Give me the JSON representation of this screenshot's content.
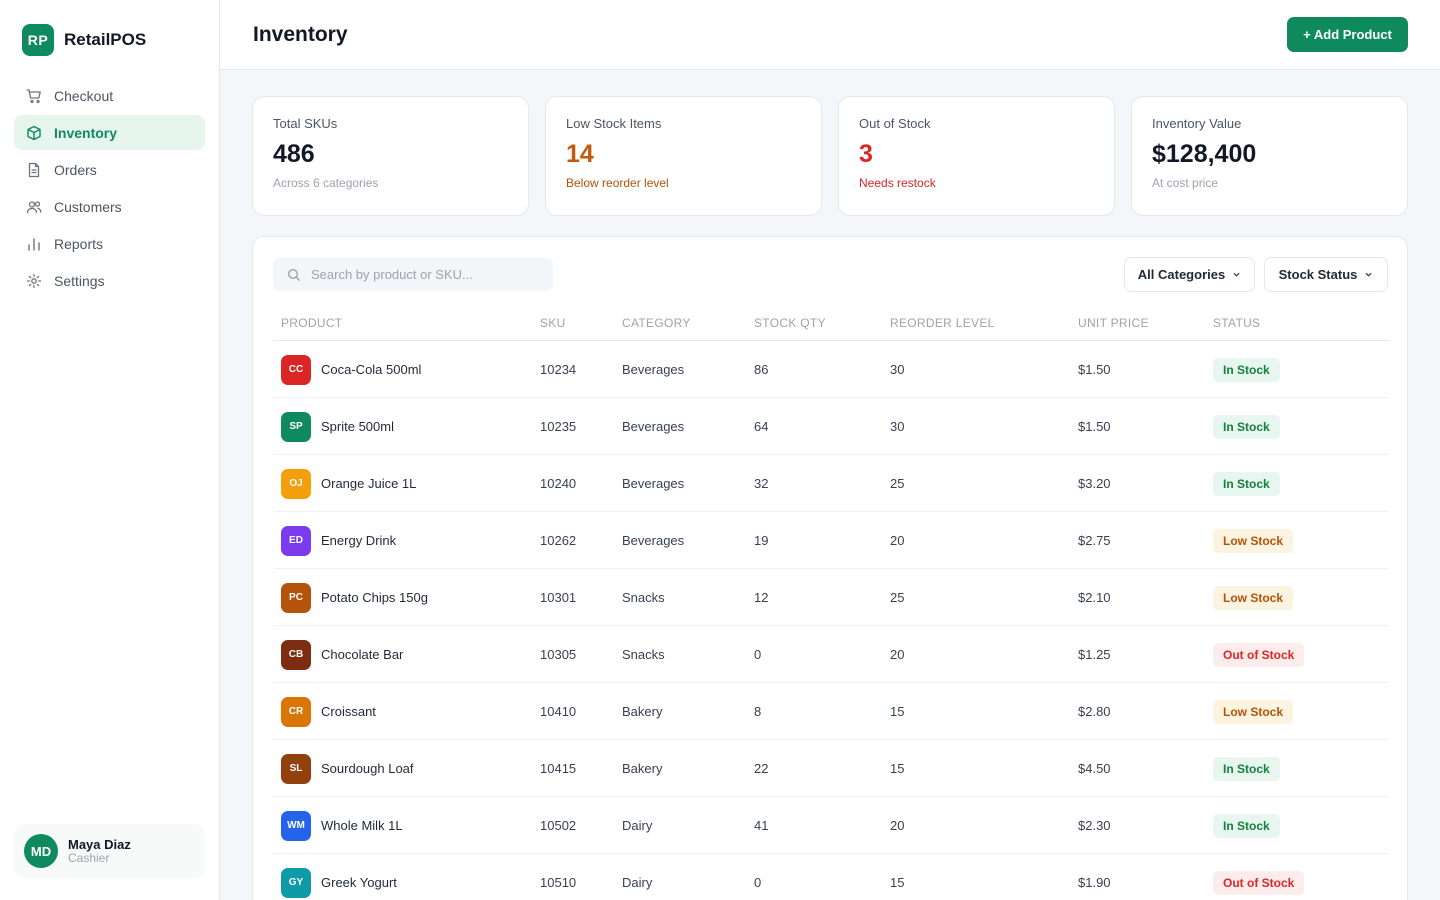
{
  "brand": {
    "logo": "RP",
    "name": "RetailPOS"
  },
  "nav": [
    {
      "label": "Checkout",
      "icon": "cart-icon",
      "active": false
    },
    {
      "label": "Inventory",
      "icon": "box-icon",
      "active": true
    },
    {
      "label": "Orders",
      "icon": "document-icon",
      "active": false
    },
    {
      "label": "Customers",
      "icon": "users-icon",
      "active": false
    },
    {
      "label": "Reports",
      "icon": "bar-chart-icon",
      "active": false
    },
    {
      "label": "Settings",
      "icon": "gear-icon",
      "active": false
    }
  ],
  "user": {
    "initials": "MD",
    "name": "Maya Diaz",
    "role": "Cashier"
  },
  "header": {
    "title": "Inventory",
    "add_button": "+ Add Product"
  },
  "stats": [
    {
      "label": "Total SKUs",
      "value": "486",
      "sub": "Across 6 categories",
      "value_color": "#111827",
      "sub_color": "#9ca3af"
    },
    {
      "label": "Low Stock Items",
      "value": "14",
      "sub": "Below reorder level",
      "value_color": "#c2590c",
      "sub_color": "#b45309"
    },
    {
      "label": "Out of Stock",
      "value": "3",
      "sub": "Needs restock",
      "value_color": "#dc2626",
      "sub_color": "#dc2626"
    },
    {
      "label": "Inventory Value",
      "value": "$128,400",
      "sub": "At cost price",
      "value_color": "#111827",
      "sub_color": "#9ca3af"
    }
  ],
  "search": {
    "placeholder": "Search by product or SKU..."
  },
  "filters": {
    "category": "All Categories",
    "status": "Stock Status"
  },
  "table": {
    "headers": [
      "PRODUCT",
      "SKU",
      "CATEGORY",
      "STOCK QTY",
      "REORDER LEVEL",
      "UNIT PRICE",
      "STATUS"
    ],
    "rows": [
      {
        "initials": "CC",
        "color": "#dc2626",
        "product": "Coca-Cola 500ml",
        "sku": "10234",
        "category": "Beverages",
        "qty": "86",
        "reorder": "30",
        "price": "$1.50",
        "status": "In Stock",
        "status_type": "in"
      },
      {
        "initials": "SP",
        "color": "#0f8a5f",
        "product": "Sprite 500ml",
        "sku": "10235",
        "category": "Beverages",
        "qty": "64",
        "reorder": "30",
        "price": "$1.50",
        "status": "In Stock",
        "status_type": "in"
      },
      {
        "initials": "OJ",
        "color": "#f59e0b",
        "product": "Orange Juice 1L",
        "sku": "10240",
        "category": "Beverages",
        "qty": "32",
        "reorder": "25",
        "price": "$3.20",
        "status": "In Stock",
        "status_type": "in"
      },
      {
        "initials": "ED",
        "color": "#7c3aed",
        "product": "Energy Drink",
        "sku": "10262",
        "category": "Beverages",
        "qty": "19",
        "reorder": "20",
        "price": "$2.75",
        "status": "Low Stock",
        "status_type": "low"
      },
      {
        "initials": "PC",
        "color": "#b45309",
        "product": "Potato Chips 150g",
        "sku": "10301",
        "category": "Snacks",
        "qty": "12",
        "reorder": "25",
        "price": "$2.10",
        "status": "Low Stock",
        "status_type": "low"
      },
      {
        "initials": "CB",
        "color": "#7c2d12",
        "product": "Chocolate Bar",
        "sku": "10305",
        "category": "Snacks",
        "qty": "0",
        "reorder": "20",
        "price": "$1.25",
        "status": "Out of Stock",
        "status_type": "out"
      },
      {
        "initials": "CR",
        "color": "#d97706",
        "product": "Croissant",
        "sku": "10410",
        "category": "Bakery",
        "qty": "8",
        "reorder": "15",
        "price": "$2.80",
        "status": "Low Stock",
        "status_type": "low"
      },
      {
        "initials": "SL",
        "color": "#92400e",
        "product": "Sourdough Loaf",
        "sku": "10415",
        "category": "Bakery",
        "qty": "22",
        "reorder": "15",
        "price": "$4.50",
        "status": "In Stock",
        "status_type": "in"
      },
      {
        "initials": "WM",
        "color": "#2563eb",
        "product": "Whole Milk 1L",
        "sku": "10502",
        "category": "Dairy",
        "qty": "41",
        "reorder": "20",
        "price": "$2.30",
        "status": "In Stock",
        "status_type": "in"
      },
      {
        "initials": "GY",
        "color": "#0e9aa7",
        "product": "Greek Yogurt",
        "sku": "10510",
        "category": "Dairy",
        "qty": "0",
        "reorder": "15",
        "price": "$1.90",
        "status": "Out of Stock",
        "status_type": "out"
      }
    ]
  }
}
